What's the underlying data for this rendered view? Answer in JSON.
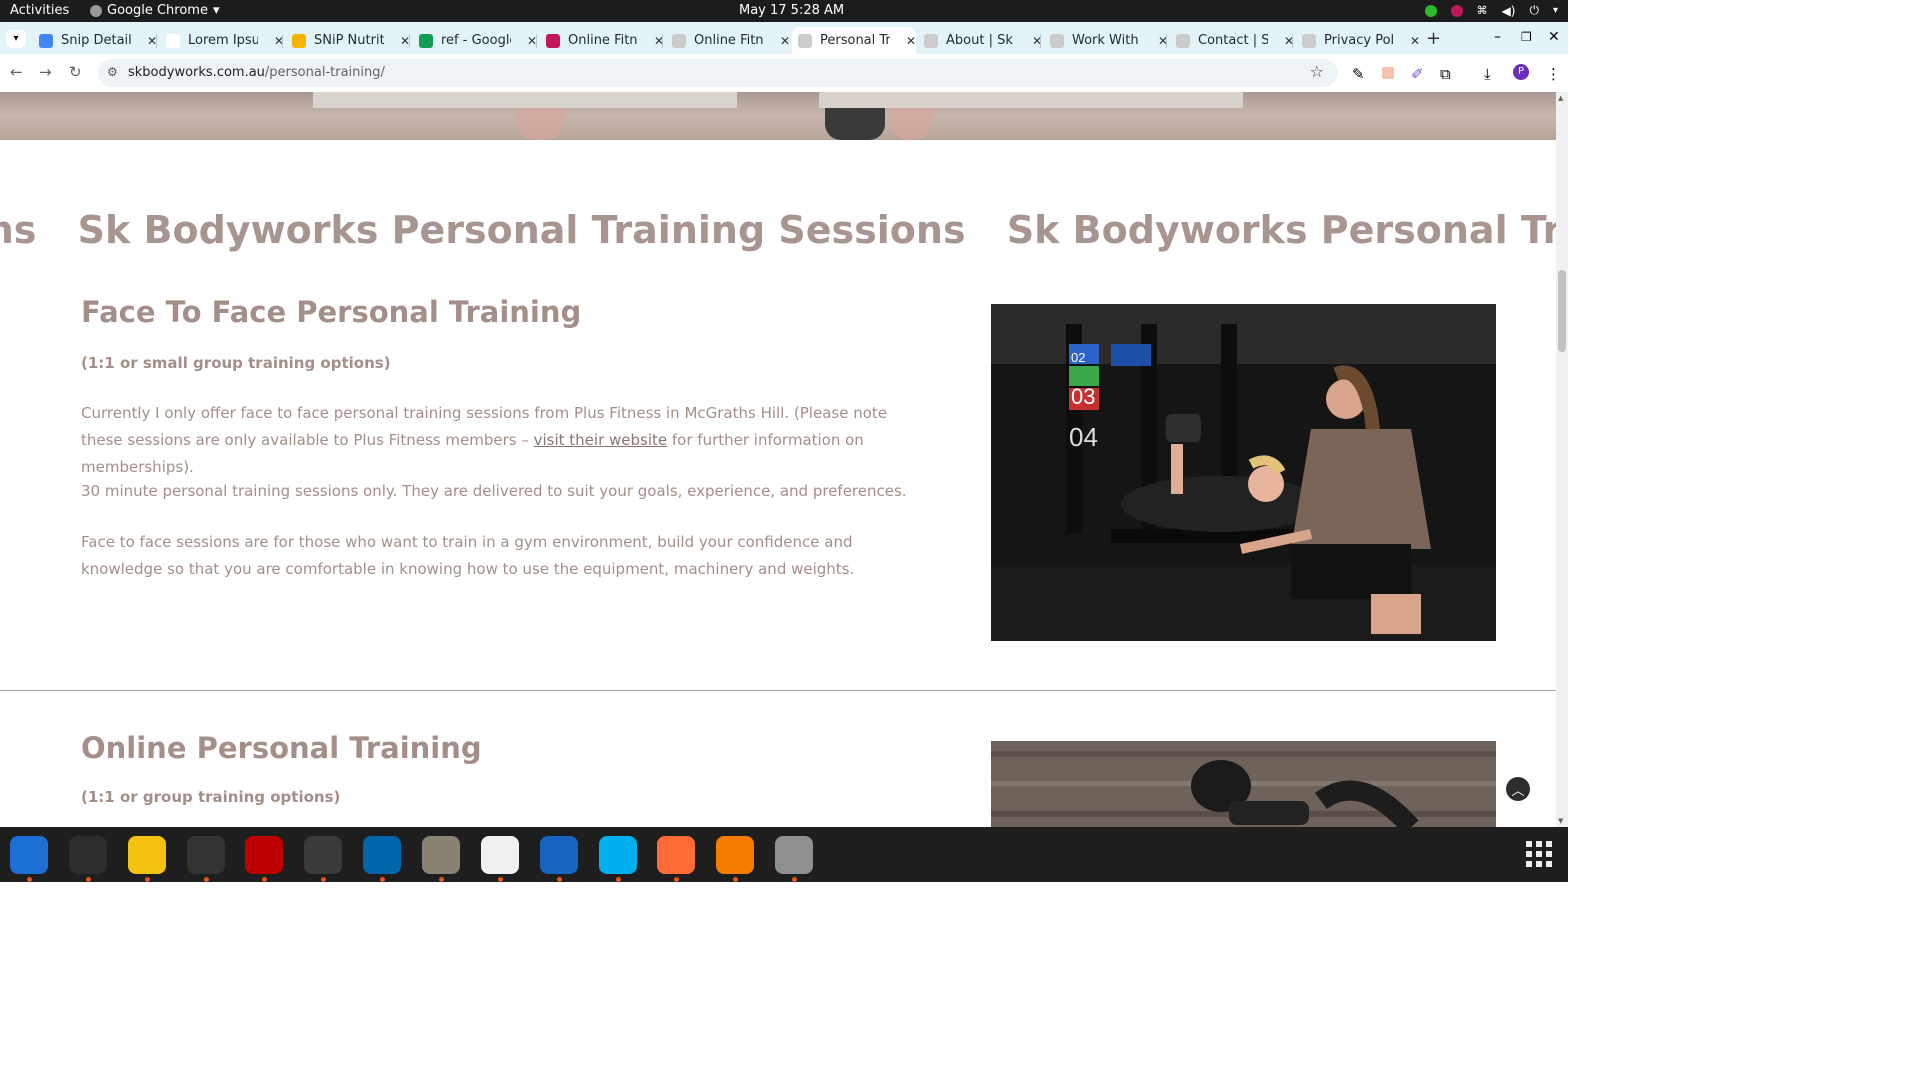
{
  "system": {
    "activities": "Activities",
    "app_name": "Google Chrome",
    "clock": "May 17  5:28 AM"
  },
  "tabs": [
    {
      "title": "Snip Details",
      "color": "#4285f4"
    },
    {
      "title": "Lorem Ipsum",
      "color": "#ffffff"
    },
    {
      "title": "SNiP Nutrition",
      "color": "#f4b400"
    },
    {
      "title": "ref - Google",
      "color": "#0f9d58"
    },
    {
      "title": "Online Fitness",
      "color": "#c2185b"
    },
    {
      "title": "Online Fitness",
      "color": "#cccccc"
    },
    {
      "title": "Personal Training",
      "color": "#cccccc",
      "active": true
    },
    {
      "title": "About | Sk B",
      "color": "#cccccc"
    },
    {
      "title": "Work With Me",
      "color": "#cccccc"
    },
    {
      "title": "Contact | Sk",
      "color": "#cccccc"
    },
    {
      "title": "Privacy Policy",
      "color": "#cccccc"
    }
  ],
  "address": {
    "domain": "skbodyworks.com.au",
    "path": "/personal-training/"
  },
  "page": {
    "marquee": [
      "sions",
      "Sk Bodyworks Personal Training Sessions",
      "Sk Bodyworks Personal Training"
    ],
    "section1": {
      "title": "Face To Face Personal Training",
      "subtitle": "(1:1 or small group training options)",
      "p1_before": "Currently I only offer face to face personal training sessions from Plus Fitness in McGraths Hill. (Please note these sessions are only available to Plus Fitness members – ",
      "p1_link": "visit their website",
      "p1_after": " for further information on memberships).",
      "p2": "30 minute personal training sessions only. They are delivered to suit your goals, experience, and preferences.",
      "p3": "Face to face sessions are for those who want to train in a gym environment, build your confidence and knowledge so that you are comfortable in knowing how to use the equipment, machinery and weights.",
      "plate_labels": [
        "02",
        "03",
        "04"
      ]
    },
    "section2": {
      "title": "Online Personal Training",
      "subtitle": "(1:1 or group training options)"
    }
  },
  "dock": [
    {
      "name": "thunderbird",
      "color": "#1d6fd6"
    },
    {
      "name": "terminal",
      "color": "#2c2c2c"
    },
    {
      "name": "notes",
      "color": "#f5c211"
    },
    {
      "name": "system-monitor",
      "color": "#333333"
    },
    {
      "name": "filezilla",
      "color": "#bf0000"
    },
    {
      "name": "chrome",
      "color": "#3a3a3a"
    },
    {
      "name": "vscode",
      "color": "#0065a9"
    },
    {
      "name": "files",
      "color": "#8a8273"
    },
    {
      "name": "text-editor",
      "color": "#f0f0f0"
    },
    {
      "name": "libreoffice-writer",
      "color": "#1565c0"
    },
    {
      "name": "skype",
      "color": "#00aff0"
    },
    {
      "name": "postman",
      "color": "#ff6c37"
    },
    {
      "name": "firefox-dev",
      "color": "#f57c00"
    },
    {
      "name": "disk",
      "color": "#8f8f8f"
    }
  ]
}
